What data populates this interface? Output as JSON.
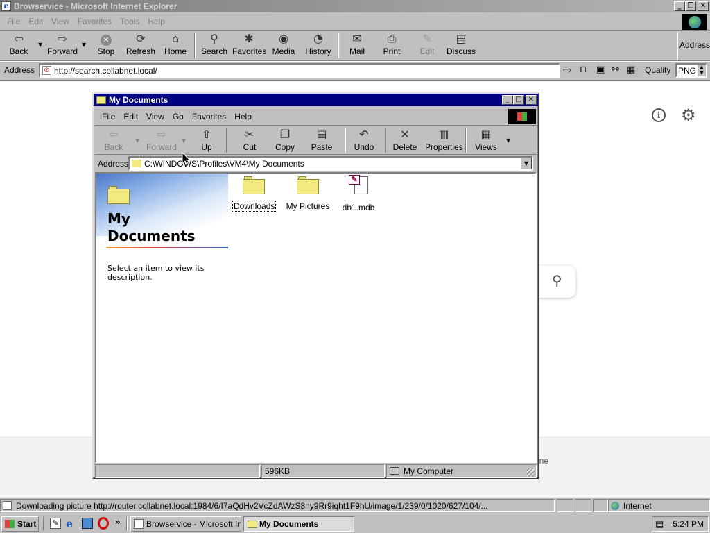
{
  "ie": {
    "title": "Browservice - Microsoft Internet Explorer",
    "menu": [
      "File",
      "Edit",
      "View",
      "Favorites",
      "Tools",
      "Help"
    ],
    "toolbar": {
      "back": "Back",
      "forward": "Forward",
      "stop": "Stop",
      "refresh": "Refresh",
      "home": "Home",
      "search": "Search",
      "favorites": "Favorites",
      "media": "Media",
      "history": "History",
      "mail": "Mail",
      "print": "Print",
      "edit": "Edit",
      "discuss": "Discuss",
      "address": "Address"
    },
    "address_label": "Address",
    "url": "http://search.collabnet.local/",
    "quality_label": "Quality",
    "quality_value": "PNG",
    "status_text": "Downloading picture http://router.collabnet.local:1984/6/I7aQdHv2VcZdAWzS8ny9Rr9iqht1F9hU/image/1/239/0/1020/627/104/...",
    "status_zone": "Internet"
  },
  "page_fragment": {
    "behind_text": "ine"
  },
  "explorer": {
    "title": "My Documents",
    "menu": [
      "File",
      "Edit",
      "View",
      "Go",
      "Favorites",
      "Help"
    ],
    "toolbar": {
      "back": "Back",
      "forward": "Forward",
      "up": "Up",
      "cut": "Cut",
      "copy": "Copy",
      "paste": "Paste",
      "undo": "Undo",
      "delete": "Delete",
      "properties": "Properties",
      "views": "Views"
    },
    "address_label": "Address",
    "address_path": "C:\\WINDOWS\\Profiles\\VM4\\My Documents",
    "sidebar": {
      "heading_line1": "My",
      "heading_line2": "Documents",
      "description": "Select an item to view its description."
    },
    "items": [
      {
        "name": "Downloads"
      },
      {
        "name": "My Pictures"
      },
      {
        "name": "db1.mdb"
      }
    ],
    "status_size": "596KB",
    "status_location": "My Computer"
  },
  "taskbar": {
    "start": "Start",
    "buttons": [
      "Browservice - Microsoft Int...",
      "My Documents"
    ],
    "clock": "5:24 PM"
  }
}
